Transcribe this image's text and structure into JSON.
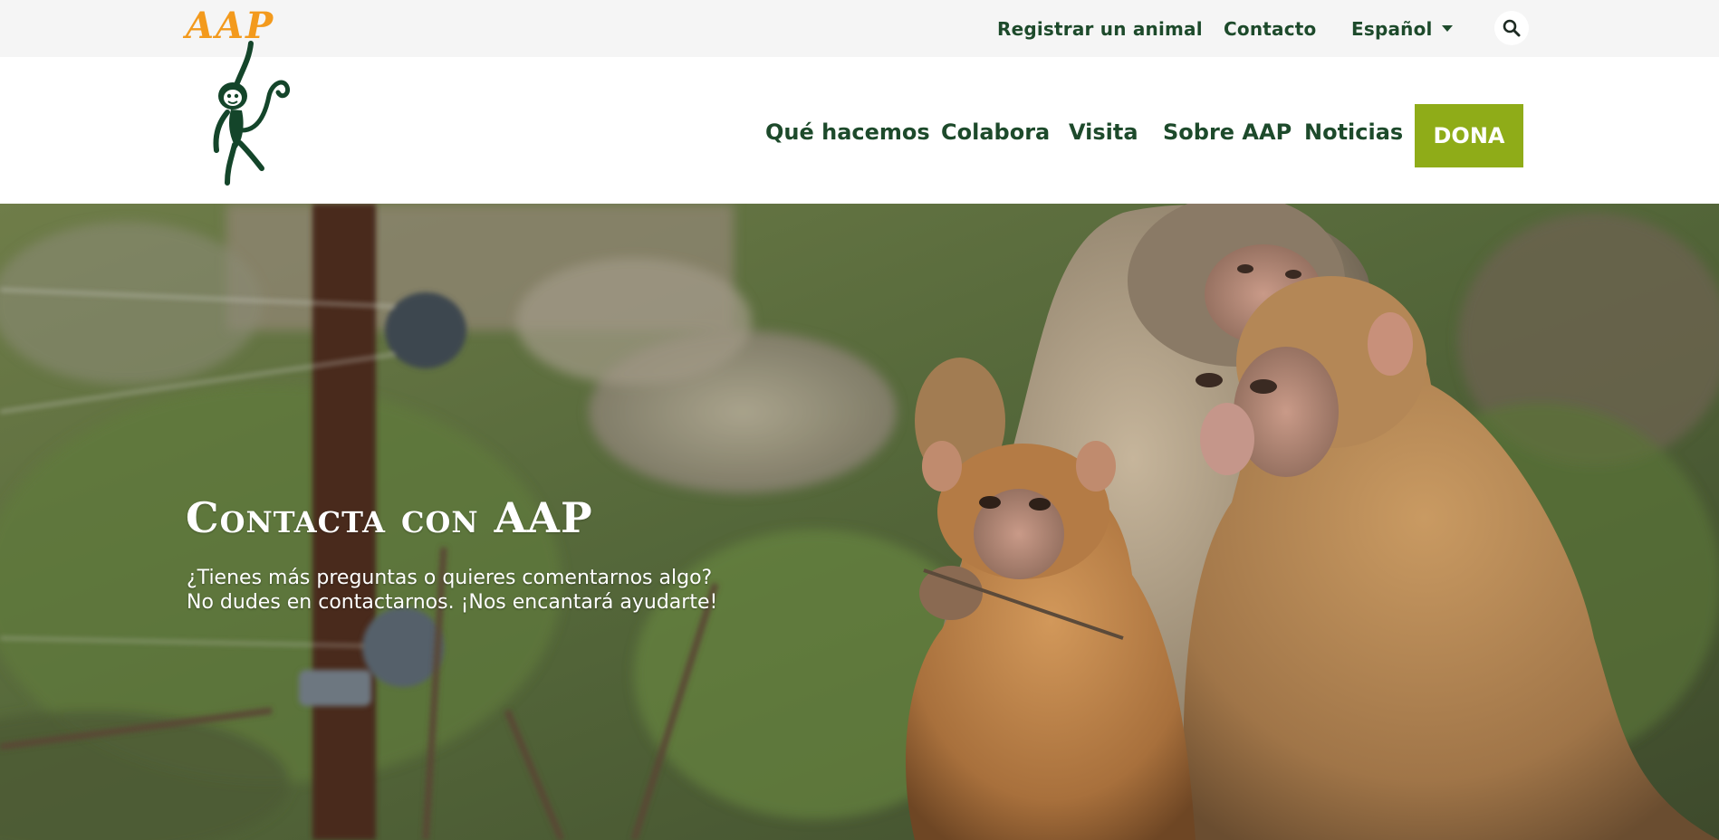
{
  "brand": {
    "logo_text": "AAP",
    "logo_color": "#f39a1d",
    "primary_color": "#1d4a2b",
    "donate_color": "#8fac18"
  },
  "topbar": {
    "register_label": "Registrar un animal",
    "contact_label": "Contacto",
    "language_label": "Español",
    "search_icon": "search-icon"
  },
  "nav": {
    "items": [
      {
        "label": "Qué hacemos"
      },
      {
        "label": "Colabora"
      },
      {
        "label": "Visita"
      },
      {
        "label": "Sobre AAP"
      },
      {
        "label": "Noticias"
      }
    ],
    "donate_label": "DONA"
  },
  "hero": {
    "title": "Contacta con AAP",
    "subtitle_line1": "¿Tienes más preguntas o quieres comentarnos algo?",
    "subtitle_line2": "No dudes en contactarnos. ¡Nos encantará ayudarte!"
  }
}
